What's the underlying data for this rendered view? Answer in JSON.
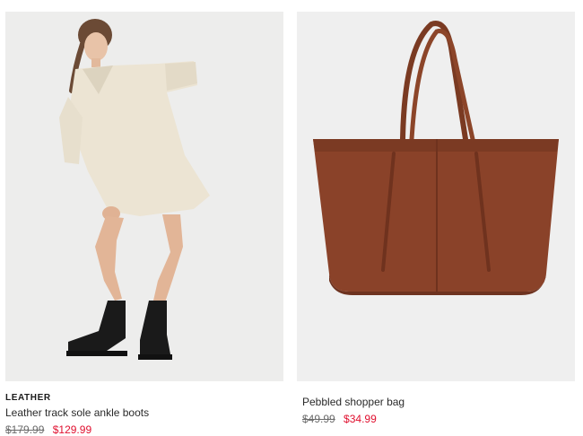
{
  "products": [
    {
      "tag": "LEATHER",
      "name": "Leather track sole ankle boots",
      "old_price": "$179.99",
      "price": "$129.99",
      "image_icon": "model-in-knit-dress-photo"
    },
    {
      "tag": "",
      "name": "Pebbled shopper bag",
      "old_price": "$49.99",
      "price": "$34.99",
      "image_icon": "brown-leather-tote-bag-photo"
    }
  ],
  "colors": {
    "sale_price": "#e0102f",
    "old_price": "#6b6b6b",
    "image_background": "#eeeeee",
    "bag_leather": "#8a4229"
  }
}
